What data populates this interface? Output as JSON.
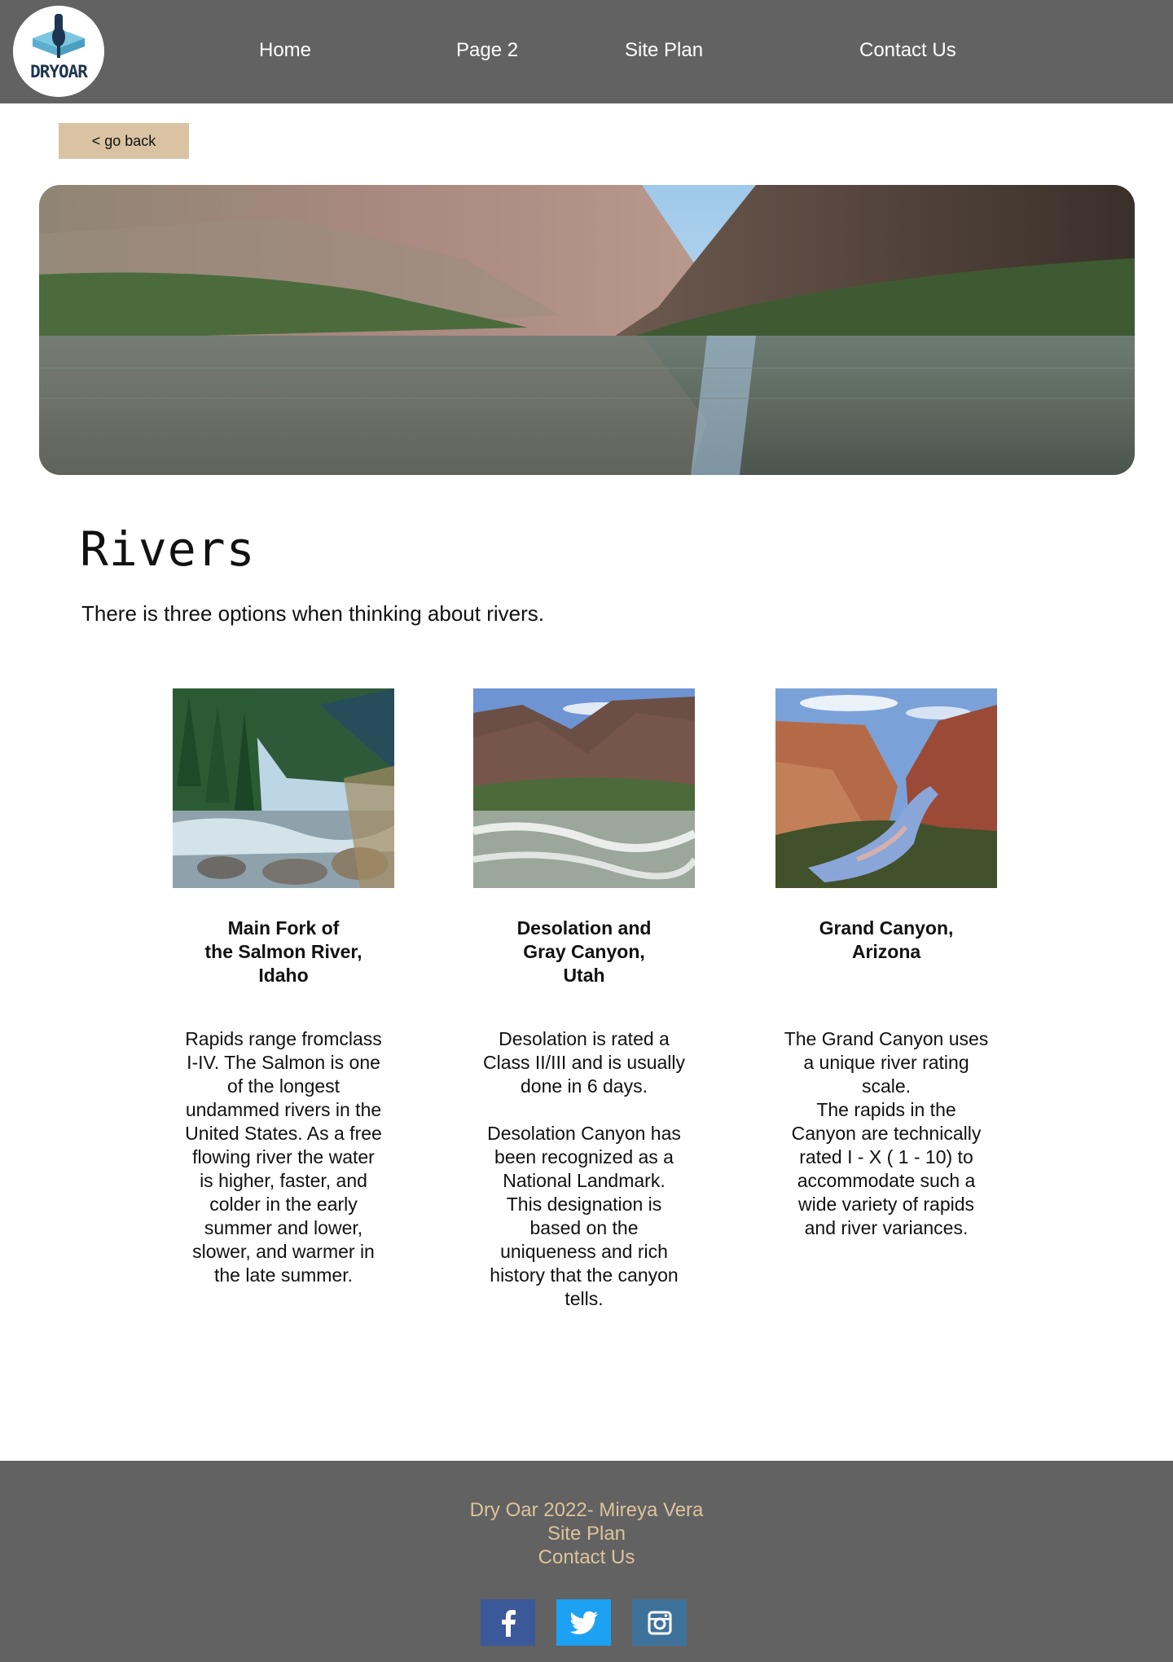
{
  "header": {
    "logo_text": "DRYOAR",
    "nav": [
      {
        "label": "Home"
      },
      {
        "label": "Page 2"
      },
      {
        "label": "Site Plan"
      },
      {
        "label": "Contact Us"
      }
    ]
  },
  "back_button": {
    "label": "< go back"
  },
  "hero": {
    "image": "canyon-river-reflection"
  },
  "main": {
    "title": "Rivers",
    "intro": "There is three options when thinking about rivers.",
    "cards": [
      {
        "image": "salmon-river-forest-rapids",
        "title": "Main Fork of\nthe Salmon River,\nIdaho",
        "text": "Rapids range fromclass\nI-IV. The Salmon is one\nof the longest\nundammed rivers in the\nUnited States. As a free\nflowing river the water\nis higher, faster, and\ncolder in the early\nsummer and lower,\nslower, and warmer in\nthe late summer."
      },
      {
        "image": "desolation-canyon-rapids",
        "title": "Desolation and\nGray Canyon,\nUtah",
        "text": "Desolation is rated a\nClass II/III and is usually\ndone in 6 days.\n\nDesolation Canyon has\nbeen recognized as a\nNational Landmark.\nThis designation is\nbased on the\nuniqueness and rich\nhistory that the canyon\ntells."
      },
      {
        "image": "grand-canyon-river",
        "title": "Grand Canyon,\nArizona",
        "text": "The Grand Canyon uses\na unique river rating\nscale.\nThe rapids in the\nCanyon are technically\nrated I - X ( 1 - 10) to\naccommodate such a\nwide variety of rapids\nand river variances."
      }
    ]
  },
  "footer": {
    "copyright": "Dry Oar 2022- Mireya Vera",
    "site_plan": "Site Plan",
    "contact": "Contact Us",
    "social": [
      {
        "icon": "facebook-icon",
        "color": "#3b5998"
      },
      {
        "icon": "twitter-icon",
        "color": "#1da1f2"
      },
      {
        "icon": "instagram-icon",
        "color": "#3f729b"
      }
    ]
  },
  "colors": {
    "header_bg": "#626262",
    "button_bg": "#d9c3a2",
    "footer_text": "#dcc39c"
  }
}
